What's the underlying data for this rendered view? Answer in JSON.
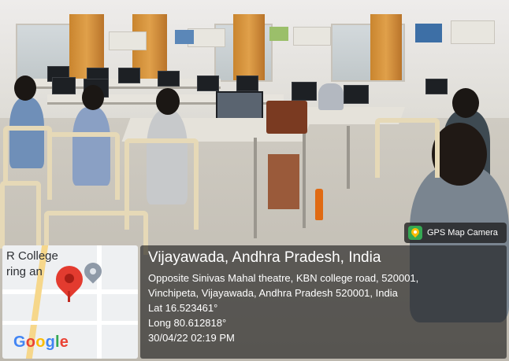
{
  "badge": {
    "label": "GPS Map Camera",
    "icon": "map-pin-app-icon"
  },
  "map": {
    "label_line1": "R College",
    "label_line2": "ring an",
    "logo": "Google"
  },
  "location": {
    "title": "Vijayawada, Andhra Pradesh, India",
    "address_line1": "Opposite Sinivas Mahal theatre, KBN college road, 520001,",
    "address_line2": "Vinchipeta, Vijayawada, Andhra Pradesh 520001, India",
    "latitude": "Lat 16.523461°",
    "longitude": "Long 80.612818°",
    "datetime": "30/04/22 02:19 PM"
  },
  "colors": {
    "pin_red": "#e33b2f",
    "panel_bg": "#191919",
    "curtain": "#d99440",
    "chair": "#e6d9b7"
  }
}
